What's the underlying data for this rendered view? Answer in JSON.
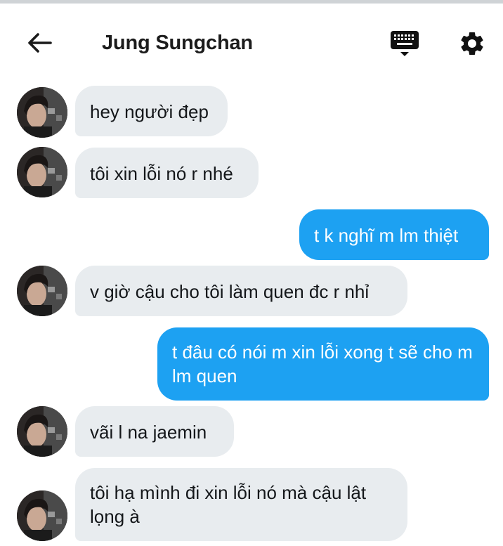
{
  "header": {
    "title": "Jung Sungchan",
    "back_icon": "arrow-left-icon",
    "keyboard_icon": "keyboard-icon",
    "settings_icon": "gear-icon"
  },
  "colors": {
    "incoming_bubble": "#e8ecef",
    "outgoing_bubble": "#1da1f2",
    "text_dark": "#14171a"
  },
  "messages": [
    {
      "direction": "incoming",
      "text": "hey người đẹp"
    },
    {
      "direction": "incoming",
      "text": "tôi xin lỗi nó r nhé"
    },
    {
      "direction": "outgoing",
      "text": "t k nghĩ m lm thiệt"
    },
    {
      "direction": "incoming",
      "text": "v giờ cậu cho tôi làm quen đc r nhỉ"
    },
    {
      "direction": "outgoing",
      "text": "t đâu có nói m xin lỗi xong t sẽ cho m lm quen"
    },
    {
      "direction": "incoming",
      "text": "vãi l na jaemin"
    },
    {
      "direction": "incoming",
      "text": "tôi hạ mình đi xin lỗi nó mà cậu lật lọng à"
    }
  ]
}
